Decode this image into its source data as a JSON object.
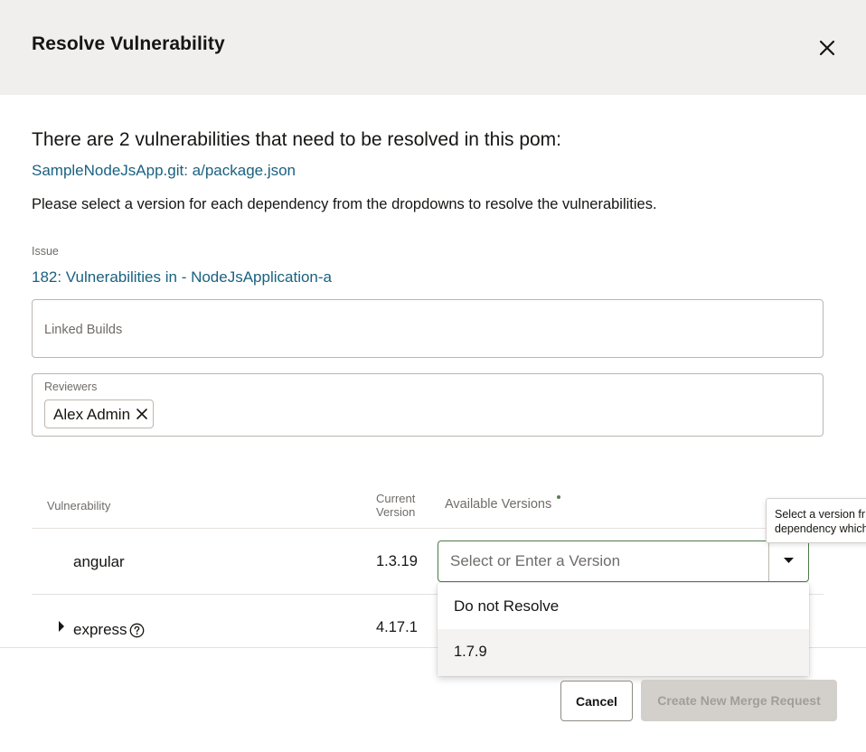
{
  "dialog": {
    "title": "Resolve Vulnerability",
    "close_icon": "close-icon"
  },
  "intro": {
    "summary": "There are 2 vulnerabilities that need to be resolved in this pom:",
    "file_link": "SampleNodeJsApp.git: a/package.json",
    "instructions": "Please select a version for each dependency from the dropdowns to resolve the vulnerabilities."
  },
  "issue": {
    "label": "Issue",
    "link": "182: Vulnerabilities in - NodeJsApplication-a"
  },
  "linked_builds": {
    "placeholder": "Linked Builds"
  },
  "reviewers": {
    "label": "Reviewers",
    "chips": [
      {
        "name": "Alex Admin",
        "remove_icon": "close-icon"
      }
    ]
  },
  "table": {
    "headers": {
      "vulnerability": "Vulnerability",
      "current_version": "Current\nVersion",
      "available_versions": "Available Versions"
    },
    "rows": [
      {
        "name": "angular",
        "current_version": "1.3.19",
        "expandable": false
      },
      {
        "name": "express",
        "current_version": "4.17.1",
        "expandable": true,
        "help_icon": "help-circle-icon"
      }
    ]
  },
  "version_select": {
    "placeholder": "Select or Enter a Version",
    "options": [
      "Do not Resolve",
      "1.7.9"
    ],
    "highlighted_option": "1.7.9"
  },
  "tooltip": {
    "text": "Select a version fr\ndependency which"
  },
  "footer": {
    "cancel_label": "Cancel",
    "create_label": "Create New Merge Request",
    "create_disabled": true
  },
  "colors": {
    "header_bg": "#f1efed",
    "link": "#1a6180",
    "focus_border": "#4d7a49",
    "disabled_button_bg": "#d3cfcb",
    "disabled_button_text": "#a19d98"
  }
}
